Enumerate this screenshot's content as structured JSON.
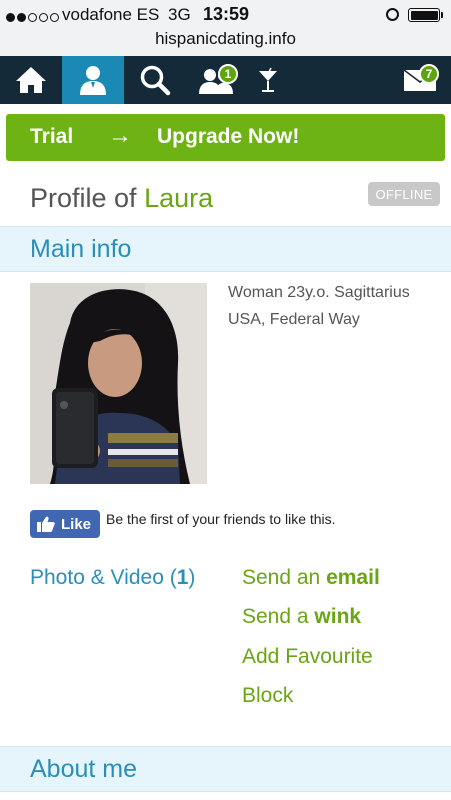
{
  "status_bar": {
    "carrier": "vodafone ES",
    "network": "3G",
    "time": "13:59",
    "url": "hispanicdating.info"
  },
  "nav": {
    "items": [
      {
        "icon": "home-icon"
      },
      {
        "icon": "profile-icon",
        "active": true
      },
      {
        "icon": "search-icon"
      },
      {
        "icon": "users-icon",
        "badge": "1"
      },
      {
        "icon": "cocktail-icon"
      },
      {
        "icon": "mail-icon",
        "badge": "7"
      }
    ]
  },
  "trial_bar": {
    "trial_label": "Trial",
    "arrow": "→",
    "upgrade_label": "Upgrade Now!"
  },
  "profile": {
    "title_prefix": "Profile of ",
    "name": "Laura",
    "status": "OFFLINE",
    "info_line1": "Woman 23y.o. Sagittarius",
    "info_line2": "USA, Federal Way"
  },
  "sections": {
    "main_info": "Main info",
    "about_me": "About me"
  },
  "like": {
    "button_label": "Like",
    "text": "Be the first of your friends to like this."
  },
  "media": {
    "label": "Photo & Video (",
    "count": "1",
    "suffix": ")"
  },
  "actions": {
    "email_prefix": "Send an ",
    "email_bold": "email",
    "wink_prefix": "Send a ",
    "wink_bold": "wink",
    "favourite": "Add Favourite",
    "block": "Block"
  },
  "colors": {
    "accent_blue": "#2a8fb8",
    "accent_green": "#6aa515",
    "nav_bg": "#142a38",
    "nav_active": "#1a8ab5",
    "trial_bg": "#6db314"
  }
}
